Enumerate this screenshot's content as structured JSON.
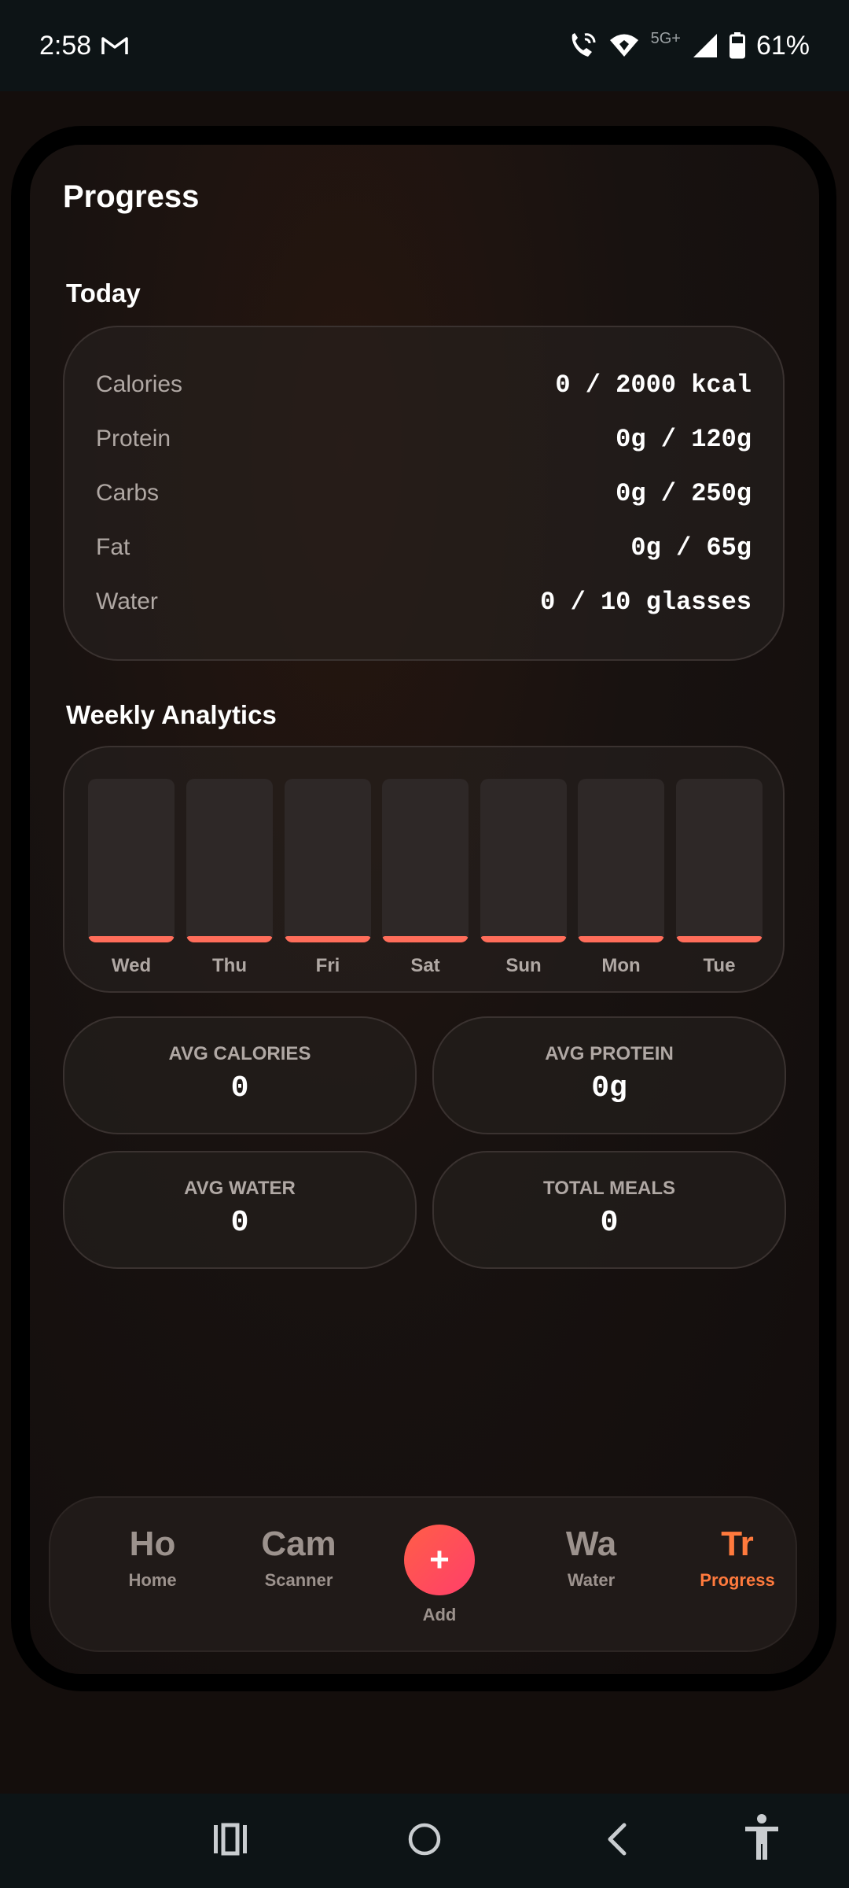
{
  "status_bar": {
    "time": "2:58",
    "network": "5G+",
    "battery": "61%",
    "icons": [
      "gmail-icon",
      "wifi-calling-icon",
      "wifi-icon",
      "signal-icon",
      "battery-icon"
    ]
  },
  "page": {
    "title": "Progress"
  },
  "today": {
    "heading": "Today",
    "rows": [
      {
        "label": "Calories",
        "value": "0 / 2000 kcal"
      },
      {
        "label": "Protein",
        "value": "0g / 120g"
      },
      {
        "label": "Carbs",
        "value": "0g / 250g"
      },
      {
        "label": "Fat",
        "value": "0g / 65g"
      },
      {
        "label": "Water",
        "value": "0 / 10 glasses"
      }
    ]
  },
  "weekly": {
    "heading": "Weekly Analytics",
    "accent_color": "#ff6d5a",
    "days": [
      "Wed",
      "Thu",
      "Fri",
      "Sat",
      "Sun",
      "Mon",
      "Tue"
    ],
    "values": [
      0,
      0,
      0,
      0,
      0,
      0,
      0
    ]
  },
  "averages": [
    {
      "label": "AVG CALORIES",
      "value": "0"
    },
    {
      "label": "AVG PROTEIN",
      "value": "0g"
    },
    {
      "label": "AVG WATER",
      "value": "0"
    },
    {
      "label": "TOTAL MEALS",
      "value": "0"
    }
  ],
  "bottom_nav": {
    "items": [
      {
        "icon_text": "Ho",
        "label": "Home"
      },
      {
        "icon_text": "Cam",
        "label": "Scanner"
      },
      {
        "icon_text": "+",
        "label": "Add"
      },
      {
        "icon_text": "Wa",
        "label": "Water"
      },
      {
        "icon_text": "Tr",
        "label": "Progress",
        "active": true
      }
    ],
    "active_color": "#ff7a3d"
  }
}
